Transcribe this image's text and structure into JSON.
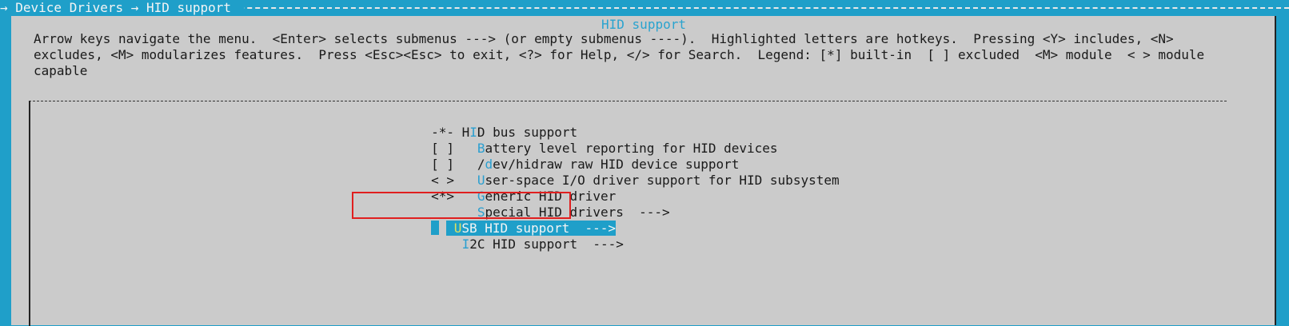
{
  "breadcrumb": "→ Device Drivers → HID support ",
  "dialog": {
    "title": "HID support",
    "help_text": "Arrow keys navigate the menu.  <Enter> selects submenus ---> (or empty submenus ----).  Highlighted letters are hotkeys.  Pressing <Y> includes, <N>\nexcludes, <M> modularizes features.  Press <Esc><Esc> to exit, <?> for Help, </> for Search.  Legend: [*] built-in  [ ] excluded  <M> module  < > module\ncapable"
  },
  "menu": {
    "items": [
      {
        "prefix": "-*- ",
        "pre": "H",
        "hot": "I",
        "rest": "D bus support"
      },
      {
        "prefix": "[ ]   ",
        "pre": "",
        "hot": "B",
        "rest": "attery level reporting for HID devices"
      },
      {
        "prefix": "[ ]   ",
        "pre": "/",
        "hot": "d",
        "rest": "ev/hidraw raw HID device support"
      },
      {
        "prefix": "< >   ",
        "pre": "",
        "hot": "U",
        "rest": "ser-space I/O driver support for HID subsystem"
      },
      {
        "prefix": "<*>   ",
        "pre": "",
        "hot": "G",
        "rest": "eneric HID driver"
      },
      {
        "prefix": "      ",
        "pre": "",
        "hot": "S",
        "rest": "pecial HID drivers  --->"
      },
      {
        "prefix": "",
        "pre": "",
        "hot": "U",
        "rest": "SB HID support  --->"
      },
      {
        "prefix": "    ",
        "pre": "",
        "hot": "I",
        "rest": "2C HID support  --->"
      }
    ]
  },
  "colors": {
    "background": "#1f9fc9",
    "dialog": "#cbcbcb",
    "hotkey": "#2a9fd0",
    "selection": "#1f9fc9",
    "annotation_box": "#e01f1f"
  }
}
